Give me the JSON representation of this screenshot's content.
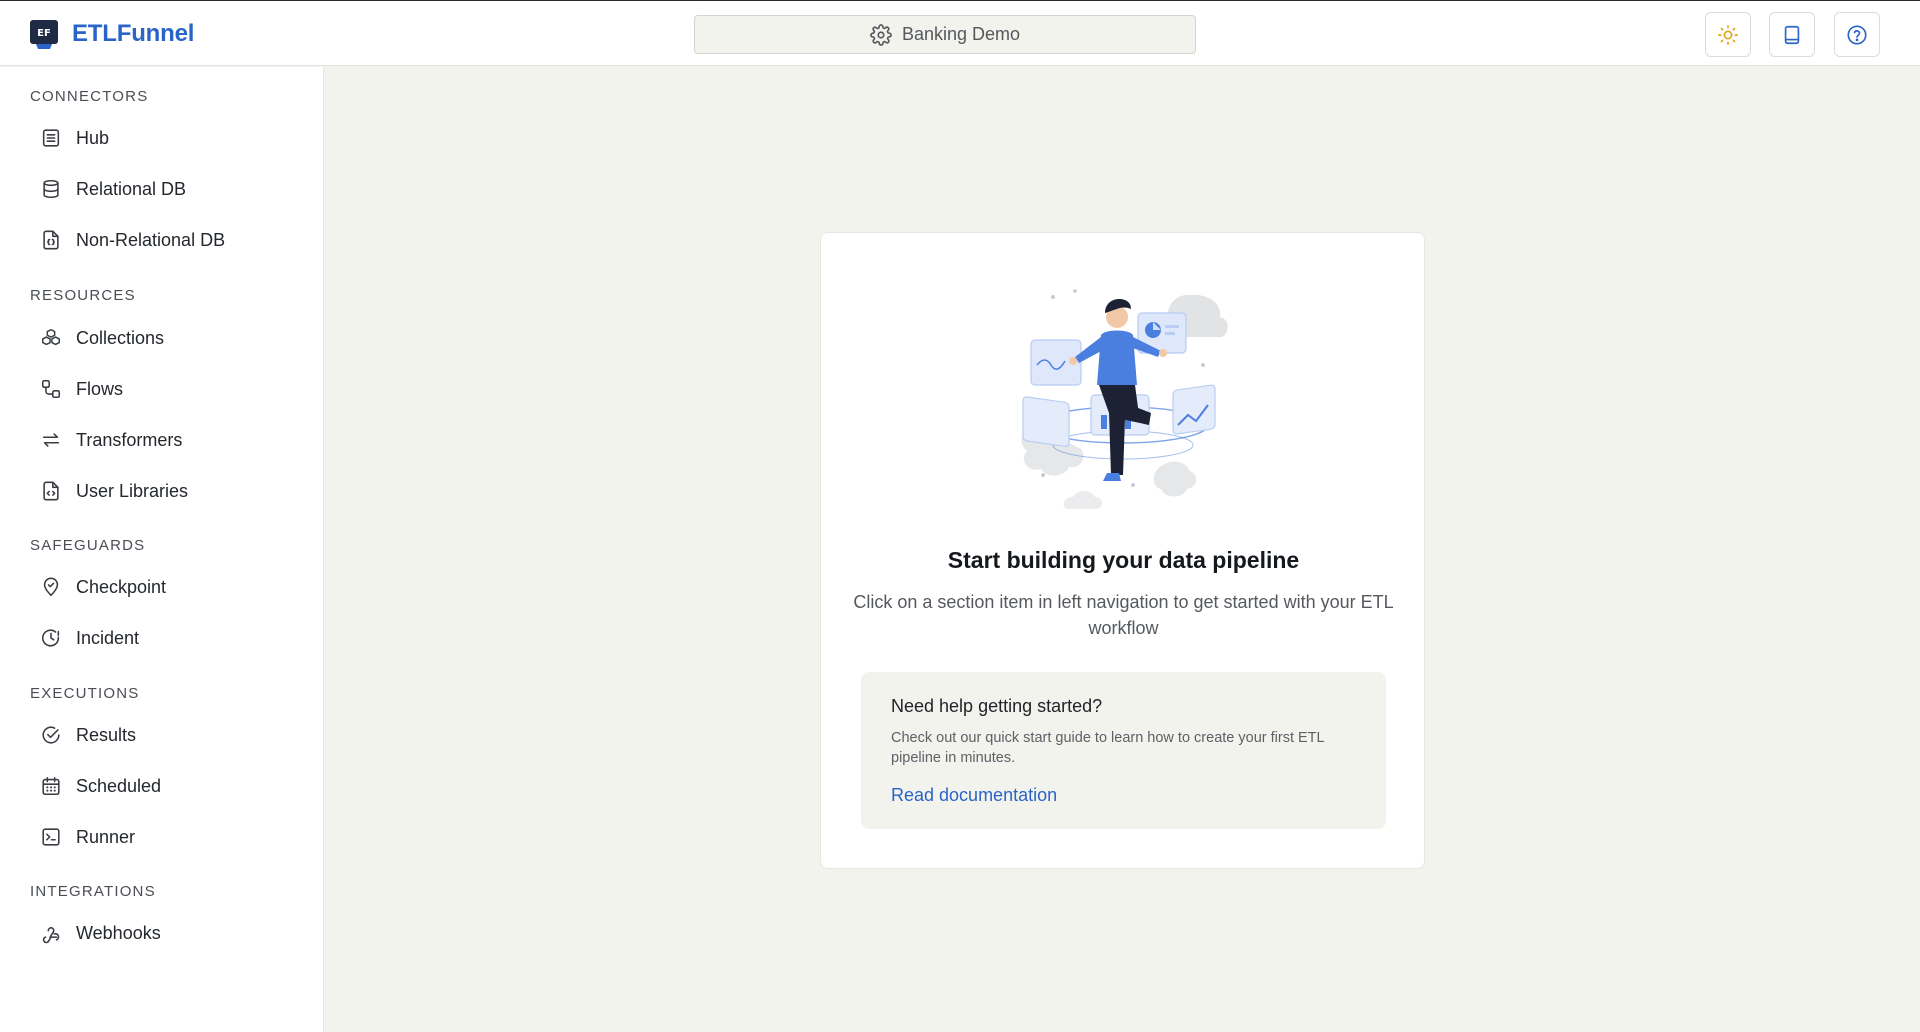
{
  "app": {
    "name": "ETLFunnel",
    "logo_text": "EF"
  },
  "header": {
    "workspace_label": "Banking Demo",
    "buttons": [
      {
        "name": "theme-toggle",
        "icon": "sun-icon"
      },
      {
        "name": "docs",
        "icon": "book-icon"
      },
      {
        "name": "help",
        "icon": "question-circle-icon"
      }
    ]
  },
  "sidebar": {
    "sections": [
      {
        "title": "CONNECTORS",
        "items": [
          {
            "label": "Hub",
            "icon": "list-icon"
          },
          {
            "label": "Relational DB",
            "icon": "database-icon"
          },
          {
            "label": "Non-Relational DB",
            "icon": "file-braces-icon"
          }
        ]
      },
      {
        "title": "RESOURCES",
        "items": [
          {
            "label": "Collections",
            "icon": "cubes-icon"
          },
          {
            "label": "Flows",
            "icon": "flow-icon"
          },
          {
            "label": "Transformers",
            "icon": "arrows-swap-icon"
          },
          {
            "label": "User Libraries",
            "icon": "file-code-icon"
          }
        ]
      },
      {
        "title": "SAFEGUARDS",
        "items": [
          {
            "label": "Checkpoint",
            "icon": "location-check-icon"
          },
          {
            "label": "Incident",
            "icon": "clock-alert-icon"
          }
        ]
      },
      {
        "title": "EXECUTIONS",
        "items": [
          {
            "label": "Results",
            "icon": "check-circle-icon"
          },
          {
            "label": "Scheduled",
            "icon": "calendar-icon"
          },
          {
            "label": "Runner",
            "icon": "terminal-icon"
          }
        ]
      },
      {
        "title": "INTEGRATIONS",
        "items": [
          {
            "label": "Webhooks",
            "icon": "webhook-icon"
          }
        ]
      }
    ]
  },
  "main": {
    "card": {
      "title": "Start building your data pipeline",
      "subtitle": "Click on a section item in left navigation to get started with your ETL workflow",
      "help": {
        "title": "Need help getting started?",
        "text": "Check out our quick start guide to learn how to create your first ETL pipeline in minutes.",
        "link": "Read documentation"
      }
    }
  },
  "colors": {
    "brand": "#2a64c8",
    "background": "#f3f3ee",
    "illustration_blue": "#4a7fe0"
  }
}
